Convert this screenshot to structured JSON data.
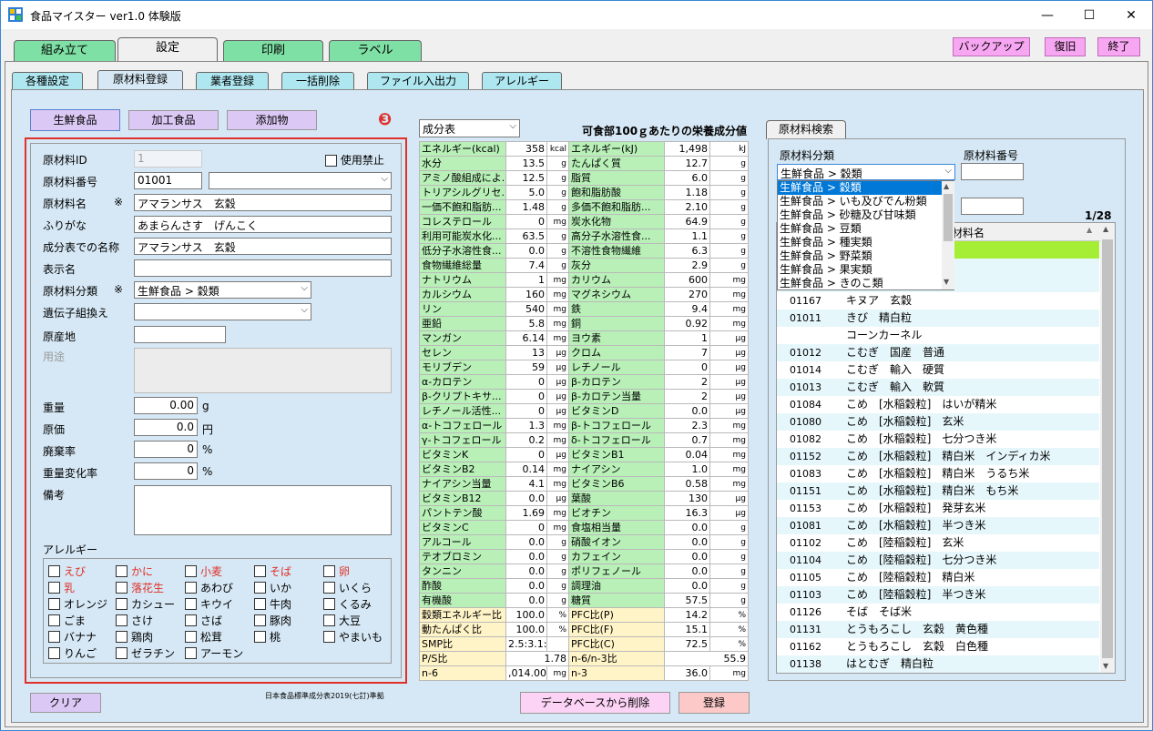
{
  "window": {
    "title": "食品マイスター ver1.0 体験版",
    "minimize": "—",
    "maximize": "☐",
    "close": "✕"
  },
  "main_tabs": [
    "組み立て",
    "設定",
    "印刷",
    "ラベル"
  ],
  "header_buttons": {
    "backup": "バックアップ",
    "restore": "復旧",
    "exit": "終了"
  },
  "sub_tabs": [
    "各種設定",
    "原材料登録",
    "業者登録",
    "一括削除",
    "ファイル入出力",
    "アレルギー"
  ],
  "category_buttons": [
    "生鮮食品",
    "加工食品",
    "添加物"
  ],
  "marker": "❸",
  "form": {
    "id_label": "原材料ID",
    "id_value": "1",
    "disabled_label": "使用禁止",
    "code_label": "原材料番号",
    "code_value": "01001",
    "name_label": "原材料名",
    "required_mark": "※",
    "name_value": "アマランサス　玄穀",
    "kana_label": "ふりがな",
    "kana_value": "あまらんさす　げんこく",
    "comp_label": "成分表での名称",
    "comp_value": "アマランサス　玄穀",
    "display_label": "表示名",
    "display_value": "",
    "class_label": "原材料分類",
    "class_value": "生鮮食品 > 穀類",
    "gmo_label": "遺伝子組換え",
    "gmo_value": "",
    "origin_label": "原産地",
    "origin_value": "",
    "use_label": "用途",
    "weight_label": "重量",
    "weight_value": "0.00",
    "weight_unit": "g",
    "cost_label": "原価",
    "cost_value": "0.0",
    "cost_unit": "円",
    "waste_label": "廃棄率",
    "waste_value": "0",
    "waste_unit": "%",
    "change_label": "重量変化率",
    "change_value": "0",
    "change_unit": "%",
    "note_label": "備考",
    "allergy_label": "アレルギー"
  },
  "allergens": [
    {
      "name": "えび",
      "red": true
    },
    {
      "name": "かに",
      "red": true
    },
    {
      "name": "小麦",
      "red": true
    },
    {
      "name": "そば",
      "red": true
    },
    {
      "name": "卵",
      "red": true
    },
    {
      "name": "乳",
      "red": true
    },
    {
      "name": "落花生",
      "red": true
    },
    {
      "name": "あわび",
      "red": false
    },
    {
      "name": "いか",
      "red": false
    },
    {
      "name": "いくら",
      "red": false
    },
    {
      "name": "オレンジ",
      "red": false
    },
    {
      "name": "カシュー",
      "red": false
    },
    {
      "name": "キウイ",
      "red": false
    },
    {
      "name": "牛肉",
      "red": false
    },
    {
      "name": "くるみ",
      "red": false
    },
    {
      "name": "ごま",
      "red": false
    },
    {
      "name": "さけ",
      "red": false
    },
    {
      "name": "さば",
      "red": false
    },
    {
      "name": "豚肉",
      "red": false
    },
    {
      "name": "大豆",
      "red": false
    },
    {
      "name": "バナナ",
      "red": false
    },
    {
      "name": "鶏肉",
      "red": false
    },
    {
      "name": "松茸",
      "red": false
    },
    {
      "name": "桃",
      "red": false
    },
    {
      "name": "やまいも",
      "red": false
    },
    {
      "name": "りんご",
      "red": false
    },
    {
      "name": "ゼラチン",
      "red": false
    },
    {
      "name": "アーモン",
      "red": false
    }
  ],
  "footer": {
    "clear": "クリア",
    "source_note": "日本食品標準成分表2019(七訂)準拠",
    "delete": "データベースから削除",
    "register": "登録"
  },
  "nutrition": {
    "table_select": "成分表",
    "heading": "可食部100ｇあたりの栄養成分値",
    "rows": [
      [
        "エネルギー(kcal)",
        "358",
        "kcal",
        "エネルギー(kJ)",
        "1,498",
        "kJ"
      ],
      [
        "水分",
        "13.5",
        "g",
        "たんぱく質",
        "12.7",
        "g"
      ],
      [
        "アミノ酸組成によ...",
        "12.5",
        "g",
        "脂質",
        "6.0",
        "g"
      ],
      [
        "トリアシルグリセ...",
        "5.0",
        "g",
        "飽和脂肪酸",
        "1.18",
        "g"
      ],
      [
        "一価不飽和脂肪...",
        "1.48",
        "g",
        "多価不飽和脂肪...",
        "2.10",
        "g"
      ],
      [
        "コレステロール",
        "0",
        "mg",
        "炭水化物",
        "64.9",
        "g"
      ],
      [
        "利用可能炭水化...",
        "63.5",
        "g",
        "高分子水溶性食...",
        "1.1",
        "g"
      ],
      [
        "低分子水溶性食...",
        "0.0",
        "g",
        "不溶性食物繊維",
        "6.3",
        "g"
      ],
      [
        "食物繊維総量",
        "7.4",
        "g",
        "灰分",
        "2.9",
        "g"
      ],
      [
        "ナトリウム",
        "1",
        "mg",
        "カリウム",
        "600",
        "mg"
      ],
      [
        "カルシウム",
        "160",
        "mg",
        "マグネシウム",
        "270",
        "mg"
      ],
      [
        "リン",
        "540",
        "mg",
        "鉄",
        "9.4",
        "mg"
      ],
      [
        "亜鉛",
        "5.8",
        "mg",
        "銅",
        "0.92",
        "mg"
      ],
      [
        "マンガン",
        "6.14",
        "mg",
        "ヨウ素",
        "1",
        "μg"
      ],
      [
        "セレン",
        "13",
        "μg",
        "クロム",
        "7",
        "μg"
      ],
      [
        "モリブデン",
        "59",
        "μg",
        "レチノール",
        "0",
        "μg"
      ],
      [
        "α-カロテン",
        "0",
        "μg",
        "β-カロテン",
        "2",
        "μg"
      ],
      [
        "β-クリプトキサ...",
        "0",
        "μg",
        "β-カロテン当量",
        "2",
        "μg"
      ],
      [
        "レチノール活性...",
        "0",
        "μg",
        "ビタミンD",
        "0.0",
        "μg"
      ],
      [
        "α-トコフェロール",
        "1.3",
        "mg",
        "β-トコフェロール",
        "2.3",
        "mg"
      ],
      [
        "γ-トコフェロール",
        "0.2",
        "mg",
        "δ-トコフェロール",
        "0.7",
        "mg"
      ],
      [
        "ビタミンK",
        "0",
        "μg",
        "ビタミンB1",
        "0.04",
        "mg"
      ],
      [
        "ビタミンB2",
        "0.14",
        "mg",
        "ナイアシン",
        "1.0",
        "mg"
      ],
      [
        "ナイアシン当量",
        "4.1",
        "mg",
        "ビタミンB6",
        "0.58",
        "mg"
      ],
      [
        "ビタミンB12",
        "0.0",
        "μg",
        "葉酸",
        "130",
        "μg"
      ],
      [
        "パントテン酸",
        "1.69",
        "mg",
        "ビオチン",
        "16.3",
        "μg"
      ],
      [
        "ビタミンC",
        "0",
        "mg",
        "食塩相当量",
        "0.0",
        "g"
      ],
      [
        "アルコール",
        "0.0",
        "g",
        "硝酸イオン",
        "0.0",
        "g"
      ],
      [
        "テオブロミン",
        "0.0",
        "g",
        "カフェイン",
        "0.0",
        "g"
      ],
      [
        "タンニン",
        "0.0",
        "g",
        "ポリフェノール",
        "0.0",
        "g"
      ],
      [
        "酢酸",
        "0.0",
        "g",
        "調理油",
        "0.0",
        "g"
      ],
      [
        "有機酸",
        "0.0",
        "g",
        "糖質",
        "57.5",
        "g"
      ]
    ],
    "rows_yellow": [
      [
        "穀類エネルギー比",
        "100.0",
        "%",
        "PFC比(P)",
        "14.2",
        "%"
      ],
      [
        "動たんぱく比",
        "100.0",
        "%",
        "PFC比(F)",
        "15.1",
        "%"
      ],
      [
        "SMP比",
        "2.5:3.1:4.4",
        "",
        "PFC比(C)",
        "72.5",
        "%"
      ]
    ],
    "ps_label": "P/S比",
    "ps_value": "1.78",
    "n63_label": "n-6/n-3比",
    "n63_value": "55.9",
    "n6_label": "n-6",
    "n6_value": ",014.00",
    "n6_unit": "mg",
    "n3_label": "n-3",
    "n3_value": "36.0",
    "n3_unit": "mg"
  },
  "search": {
    "tab": "原材料検索",
    "class_label": "原材料分類",
    "class_value": "生鮮食品 > 穀類",
    "code_label": "原材料番号",
    "page": "1/28",
    "col_name": "材料名",
    "dropdown": [
      "生鮮食品 > 穀類",
      "生鮮食品 > いも及びでん粉類",
      "生鮮食品 > 砂糖及び甘味類",
      "生鮮食品 > 豆類",
      "生鮮食品 > 種実類",
      "生鮮食品 > 野菜類",
      "生鮮食品 > 果実類",
      "生鮮食品 > きのこ類"
    ],
    "rows": [
      {
        "no": "01167",
        "name": "キヌア　玄穀"
      },
      {
        "no": "01011",
        "name": "きび　精白粒"
      },
      {
        "no": "",
        "name": "コーンカーネル"
      },
      {
        "no": "01012",
        "name": "こむぎ　国産　普通"
      },
      {
        "no": "01014",
        "name": "こむぎ　輸入　硬質"
      },
      {
        "no": "01013",
        "name": "こむぎ　輸入　軟質"
      },
      {
        "no": "01084",
        "name": "こめ　[水稲穀粒]　はいが精米"
      },
      {
        "no": "01080",
        "name": "こめ　[水稲穀粒]　玄米"
      },
      {
        "no": "01082",
        "name": "こめ　[水稲穀粒]　七分つき米"
      },
      {
        "no": "01152",
        "name": "こめ　[水稲穀粒]　精白米　インディカ米"
      },
      {
        "no": "01083",
        "name": "こめ　[水稲穀粒]　精白米　うるち米"
      },
      {
        "no": "01151",
        "name": "こめ　[水稲穀粒]　精白米　もち米"
      },
      {
        "no": "01153",
        "name": "こめ　[水稲穀粒]　発芽玄米"
      },
      {
        "no": "01081",
        "name": "こめ　[水稲穀粒]　半つき米"
      },
      {
        "no": "01102",
        "name": "こめ　[陸稲穀粒]　玄米"
      },
      {
        "no": "01104",
        "name": "こめ　[陸稲穀粒]　七分つき米"
      },
      {
        "no": "01105",
        "name": "こめ　[陸稲穀粒]　精白米"
      },
      {
        "no": "01103",
        "name": "こめ　[陸稲穀粒]　半つき米"
      },
      {
        "no": "01126",
        "name": "そば　そば米"
      },
      {
        "no": "01131",
        "name": "とうもろこし　玄穀　黄色種"
      },
      {
        "no": "01162",
        "name": "とうもろこし　玄穀　白色種"
      },
      {
        "no": "01138",
        "name": "はとむぎ　精白粒"
      }
    ]
  },
  "colors": {
    "tab_green": "#7fe0a5",
    "tab_active": "#f0f0f0",
    "subtab_cyan": "#aee7f0",
    "panel_bg": "#d6e8f5",
    "pink": "#f7a6f2",
    "lavender": "#dcc8f5",
    "red_border": "#e0302a",
    "green_cell": "#b8f0b8",
    "yellow_cell": "#fff4c7",
    "list_selected": "#a5ee35"
  }
}
